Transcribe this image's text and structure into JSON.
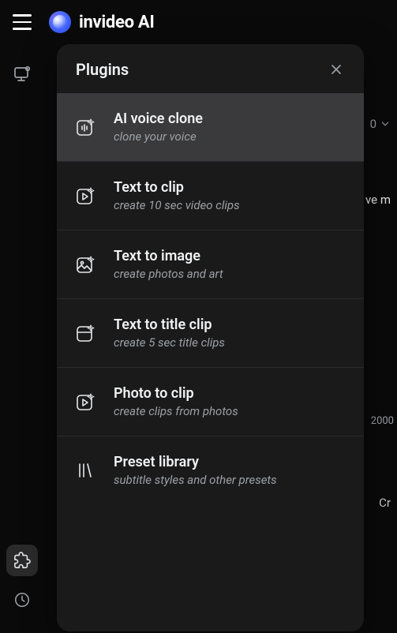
{
  "brand": {
    "title": "invideo AI"
  },
  "panel": {
    "title": "Plugins"
  },
  "plugins": [
    {
      "title": "AI voice clone",
      "sub": "clone your voice",
      "icon": "voice-clone-icon",
      "selected": true
    },
    {
      "title": "Text to clip",
      "sub": "create 10 sec video clips",
      "icon": "text-to-clip-icon",
      "selected": false
    },
    {
      "title": "Text to image",
      "sub": "create photos and art",
      "icon": "text-to-image-icon",
      "selected": false
    },
    {
      "title": "Text to title clip",
      "sub": "create 5 sec title clips",
      "icon": "text-to-title-icon",
      "selected": false
    },
    {
      "title": "Photo to clip",
      "sub": "create clips from photos",
      "icon": "photo-to-clip-icon",
      "selected": false
    },
    {
      "title": "Preset library",
      "sub": "subtitle styles and other presets",
      "icon": "preset-library-icon",
      "selected": false
    }
  ],
  "background_hints": {
    "dropdown": "0",
    "text1": "ve m",
    "text2": "2000",
    "text3": "Cr"
  }
}
